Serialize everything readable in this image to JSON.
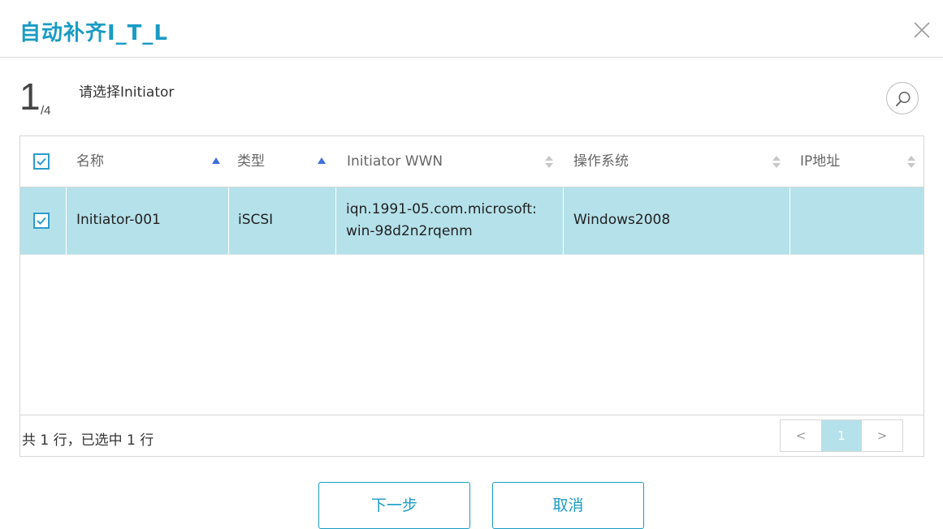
{
  "dialog": {
    "title": "自动补齐I_T_L"
  },
  "wizard": {
    "current_step": "1",
    "total_steps": "/4",
    "step_label": "请选择Initiator"
  },
  "table": {
    "columns": [
      {
        "label": "名称",
        "sort": "asc"
      },
      {
        "label": "类型",
        "sort": "asc"
      },
      {
        "label": "Initiator WWN",
        "sort": "none"
      },
      {
        "label": "操作系统",
        "sort": "none"
      },
      {
        "label": "IP地址",
        "sort": "none"
      }
    ],
    "rows": [
      {
        "selected": true,
        "name": "Initiator-001",
        "type": "iSCSI",
        "wwn_line1": "iqn.1991-05.com.microsoft:",
        "wwn_line2": "win-98d2n2rqenm",
        "os": "Windows2008",
        "ip": ""
      }
    ],
    "footer_count": "共 1 行，已选中 1 行"
  },
  "pagination": {
    "prev": "<",
    "current": "1",
    "next": ">"
  },
  "buttons": {
    "next": "下一步",
    "cancel": "取消"
  },
  "colors": {
    "accent": "#1a9bc4",
    "selected_row": "#b5e1ea",
    "sort_active": "#3f6fdb"
  },
  "icons": [
    "close-icon",
    "search-icon",
    "check-icon",
    "sort-asc-icon",
    "sort-both-icon"
  ]
}
